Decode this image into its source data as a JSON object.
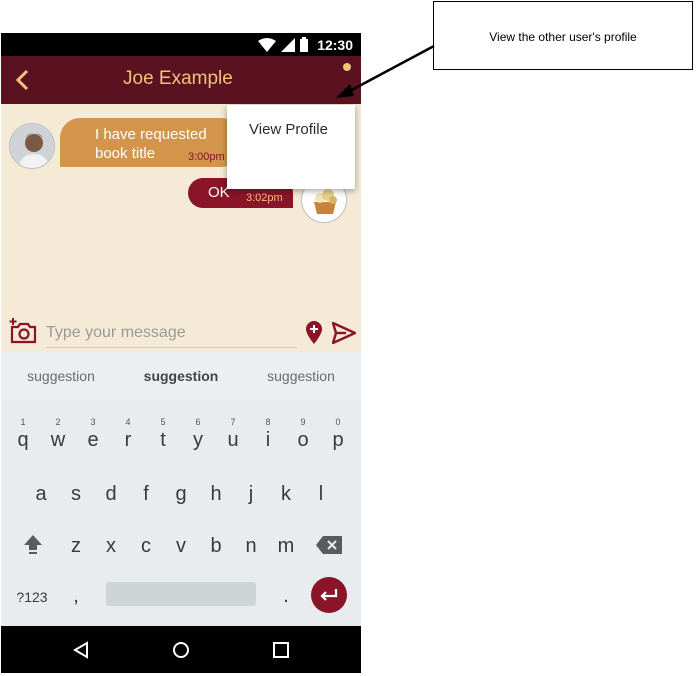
{
  "status_bar": {
    "time": "12:30"
  },
  "app_bar": {
    "title": "Joe Example"
  },
  "messages": [
    {
      "direction": "incoming",
      "text": "I have requested book title",
      "time": "3:00pm"
    },
    {
      "direction": "outgoing",
      "text": "OK",
      "time": "3:02pm"
    }
  ],
  "composer": {
    "placeholder": "Type your message"
  },
  "suggestions": [
    "suggestion",
    "suggestion",
    "suggestion"
  ],
  "keyboard": {
    "row1": [
      "q",
      "w",
      "e",
      "r",
      "t",
      "y",
      "u",
      "i",
      "o",
      "p"
    ],
    "row1_numbers": [
      "1",
      "2",
      "3",
      "4",
      "5",
      "6",
      "7",
      "8",
      "9",
      "0"
    ],
    "row2": [
      "a",
      "s",
      "d",
      "f",
      "g",
      "h",
      "j",
      "k",
      "l"
    ],
    "row3": [
      "z",
      "x",
      "c",
      "v",
      "b",
      "n",
      "m"
    ],
    "symbols_key": "?123",
    "comma_key": ",",
    "period_key": "."
  },
  "menu": {
    "items": [
      "View Profile"
    ]
  },
  "annotation": {
    "text": "View the other user's profile"
  },
  "colors": {
    "app_bar": "#5a1220",
    "accent": "#8a1428",
    "title": "#f0c27a",
    "incoming_bubble": "#d2954b",
    "chat_background": "#f4ead5"
  },
  "icons": [
    "back-arrow-icon",
    "overflow-menu-icon",
    "camera-add-icon",
    "location-pin-add-icon",
    "send-icon",
    "shift-icon",
    "backspace-icon",
    "enter-icon",
    "nav-back-icon",
    "nav-home-icon",
    "nav-recents-icon",
    "wifi-icon",
    "signal-icon",
    "battery-icon"
  ]
}
